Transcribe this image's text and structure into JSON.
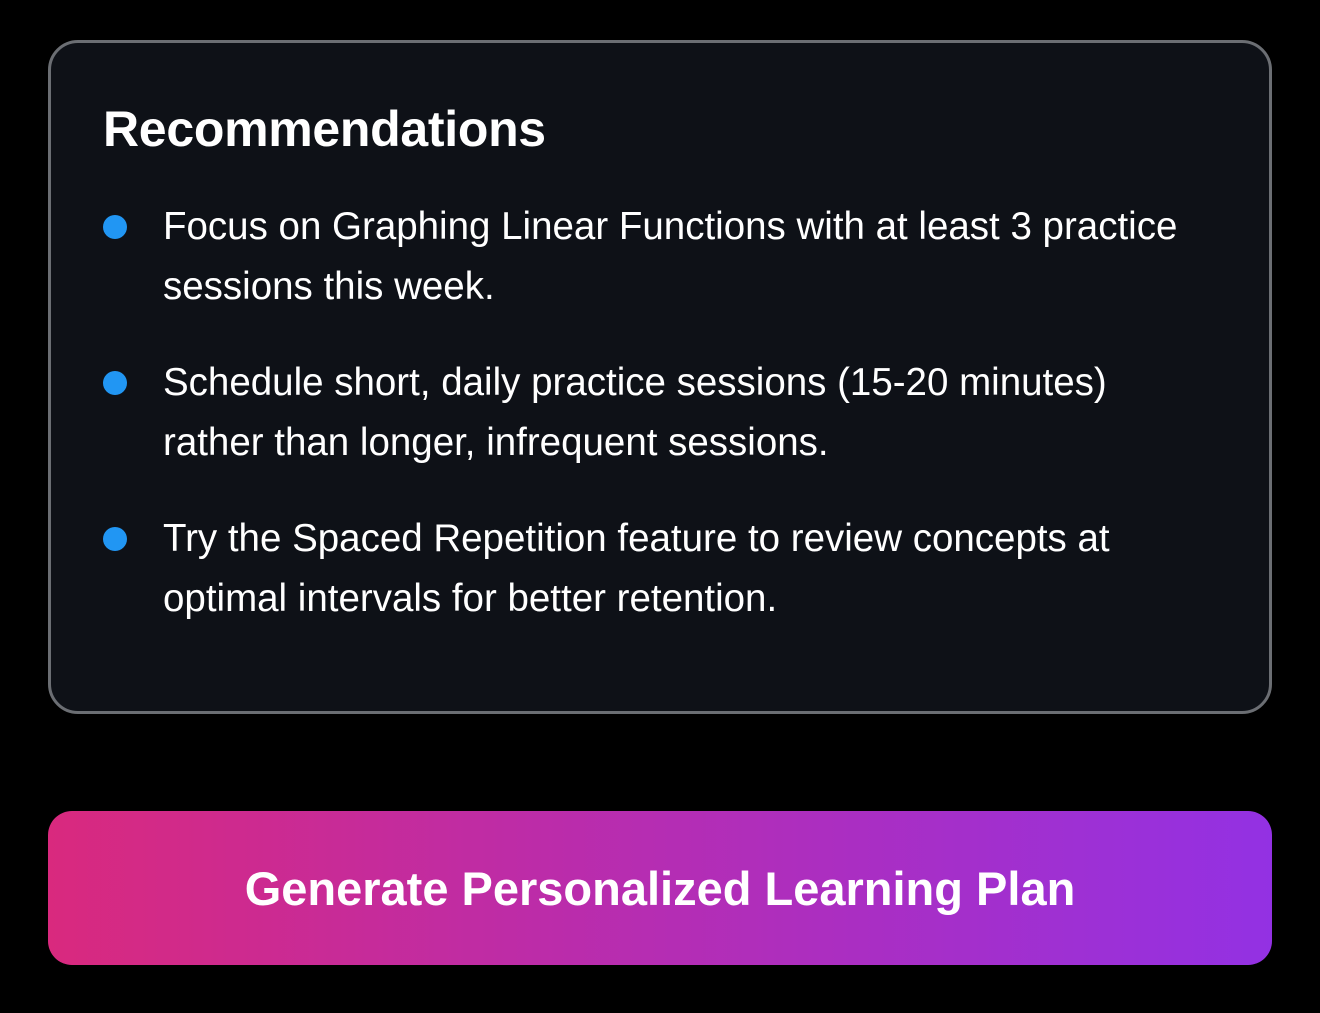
{
  "recommendations": {
    "title": "Recommendations",
    "bullet_color": "#2196f3",
    "items": [
      {
        "text": "Focus on Graphing Linear Functions with at least 3 practice sessions this week."
      },
      {
        "text": "Schedule short, daily practice sessions (15-20 minutes) rather than longer, infrequent sessions."
      },
      {
        "text": "Try the Spaced Repetition feature to review concepts at optimal intervals for better retention."
      }
    ]
  },
  "cta": {
    "label": "Generate Personalized Learning Plan",
    "gradient_start": "#d9297e",
    "gradient_end": "#9331e3"
  }
}
